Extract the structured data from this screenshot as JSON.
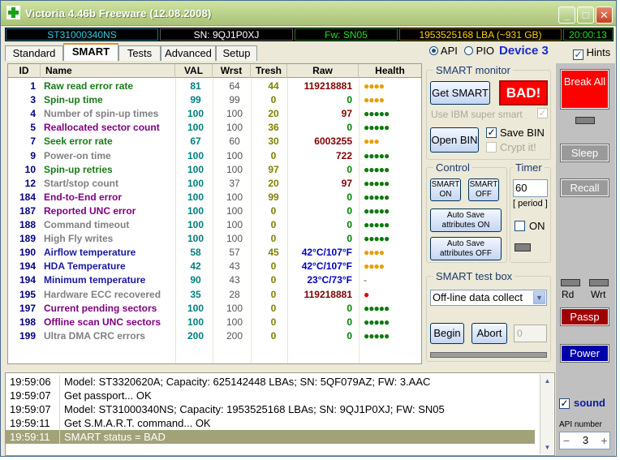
{
  "window": {
    "title": "Victoria 4.46b Freeware (12.08.2008)",
    "min_glyph": "_",
    "max_glyph": "□",
    "close_glyph": "✕"
  },
  "status": {
    "model": "ST31000340NS",
    "sn": "SN: 9QJ1P0XJ",
    "fw": "Fw: SN05",
    "lba": "1953525168 LBA (~931 GB)",
    "time": "20:00:13"
  },
  "tabs": [
    "Standard",
    "SMART",
    "Tests",
    "Advanced",
    "Setup"
  ],
  "mode": {
    "api_label": "API",
    "pio_label": "PIO",
    "device_label": "Device 3",
    "hints_label": "Hints"
  },
  "table": {
    "headers": [
      "ID",
      "Name",
      "VAL",
      "Wrst",
      "Tresh",
      "Raw",
      "Health"
    ],
    "rows": [
      {
        "id": "1",
        "name": "Raw read error rate",
        "val": "81",
        "wrst": "64",
        "tresh": "44",
        "raw": "119218881",
        "health": "●●●●",
        "name_color": "#1a7a1a",
        "health_color": "#e8a000"
      },
      {
        "id": "3",
        "name": "Spin-up time",
        "val": "99",
        "wrst": "99",
        "tresh": "0",
        "raw": "0",
        "health": "●●●●",
        "name_color": "#1a7a1a",
        "health_color": "#e8a000"
      },
      {
        "id": "4",
        "name": "Number of spin-up times",
        "val": "100",
        "wrst": "100",
        "tresh": "20",
        "raw": "97",
        "health": "●●●●●",
        "name_color": "#808080",
        "health_color": "#0a7a0a"
      },
      {
        "id": "5",
        "name": "Reallocated sector count",
        "val": "100",
        "wrst": "100",
        "tresh": "36",
        "raw": "0",
        "health": "●●●●●",
        "name_color": "#800080",
        "health_color": "#0a7a0a"
      },
      {
        "id": "7",
        "name": "Seek error rate",
        "val": "67",
        "wrst": "60",
        "tresh": "30",
        "raw": "6003255",
        "health": "●●●",
        "name_color": "#1a7a1a",
        "health_color": "#e8a000"
      },
      {
        "id": "9",
        "name": "Power-on time",
        "val": "100",
        "wrst": "100",
        "tresh": "0",
        "raw": "722",
        "health": "●●●●●",
        "name_color": "#808080",
        "health_color": "#0a7a0a"
      },
      {
        "id": "10",
        "name": "Spin-up retries",
        "val": "100",
        "wrst": "100",
        "tresh": "97",
        "raw": "0",
        "health": "●●●●●",
        "name_color": "#1a7a1a",
        "health_color": "#0a7a0a"
      },
      {
        "id": "12",
        "name": "Start/stop count",
        "val": "100",
        "wrst": "37",
        "tresh": "20",
        "raw": "97",
        "health": "●●●●●",
        "name_color": "#808080",
        "health_color": "#0a7a0a"
      },
      {
        "id": "184",
        "name": "End-to-End error",
        "val": "100",
        "wrst": "100",
        "tresh": "99",
        "raw": "0",
        "health": "●●●●●",
        "name_color": "#800080",
        "health_color": "#0a7a0a"
      },
      {
        "id": "187",
        "name": "Reported UNC error",
        "val": "100",
        "wrst": "100",
        "tresh": "0",
        "raw": "0",
        "health": "●●●●●",
        "name_color": "#800080",
        "health_color": "#0a7a0a"
      },
      {
        "id": "188",
        "name": "Command timeout",
        "val": "100",
        "wrst": "100",
        "tresh": "0",
        "raw": "0",
        "health": "●●●●●",
        "name_color": "#808080",
        "health_color": "#0a7a0a"
      },
      {
        "id": "189",
        "name": "High Fly writes",
        "val": "100",
        "wrst": "100",
        "tresh": "0",
        "raw": "0",
        "health": "●●●●●",
        "name_color": "#808080",
        "health_color": "#0a7a0a"
      },
      {
        "id": "190",
        "name": "Airflow temperature",
        "val": "58",
        "wrst": "57",
        "tresh": "45",
        "raw": "42°C/107°F",
        "health": "●●●●",
        "name_color": "#1a1aa0",
        "health_color": "#e8a000"
      },
      {
        "id": "194",
        "name": "HDA Temperature",
        "val": "42",
        "wrst": "43",
        "tresh": "0",
        "raw": "42°C/107°F",
        "health": "●●●●",
        "name_color": "#1a1aa0",
        "health_color": "#e8a000"
      },
      {
        "id": "194",
        "name": "Minimum temperature",
        "val": "90",
        "wrst": "43",
        "tresh": "0",
        "raw": "23°C/73°F",
        "health": "-",
        "name_color": "#1a1aa0",
        "health_color": "#0a7a0a"
      },
      {
        "id": "195",
        "name": "Hardware ECC recovered",
        "val": "35",
        "wrst": "28",
        "tresh": "0",
        "raw": "119218881",
        "health": "●",
        "name_color": "#808080",
        "health_color": "#e00000"
      },
      {
        "id": "197",
        "name": "Current pending sectors",
        "val": "100",
        "wrst": "100",
        "tresh": "0",
        "raw": "0",
        "health": "●●●●●",
        "name_color": "#800080",
        "health_color": "#0a7a0a"
      },
      {
        "id": "198",
        "name": "Offline scan UNC sectors",
        "val": "100",
        "wrst": "100",
        "tresh": "0",
        "raw": "0",
        "health": "●●●●●",
        "name_color": "#800080",
        "health_color": "#0a7a0a"
      },
      {
        "id": "199",
        "name": "Ultra DMA CRC errors",
        "val": "200",
        "wrst": "200",
        "tresh": "0",
        "raw": "0",
        "health": "●●●●●",
        "name_color": "#808080",
        "health_color": "#0a7a0a"
      }
    ]
  },
  "smart_monitor": {
    "label": "SMART monitor",
    "get_smart": "Get SMART",
    "status": "BAD!",
    "use_ibm": "Use IBM super smart",
    "open_bin": "Open BIN",
    "save_bin": "Save BIN",
    "crypt_it": "Crypt it!"
  },
  "control": {
    "label": "Control",
    "smart_on": "SMART ON",
    "smart_off": "SMART OFF",
    "autosave_on": "Auto Save attributes ON",
    "autosave_off": "Auto Save attributes OFF"
  },
  "timer": {
    "label": "Timer",
    "value": "60",
    "period": "[ period ]",
    "on_label": "ON"
  },
  "test_box": {
    "label": "SMART test box",
    "selected": "Off-line data collect",
    "begin": "Begin",
    "abort": "Abort",
    "value": "0"
  },
  "right": {
    "break_all": "Break All",
    "sleep": "Sleep",
    "recall": "Recall",
    "rd": "Rd",
    "wrt": "Wrt",
    "passp": "Passp",
    "power": "Power",
    "sound": "sound",
    "api_number_label": "API number",
    "api_number": "3",
    "minus": "−",
    "plus": "+"
  },
  "log": [
    {
      "time": "19:59:06",
      "msg": "Model: ST3320620A; Capacity: 625142448 LBAs; SN: 5QF079AZ; FW: 3.AAC"
    },
    {
      "time": "19:59:07",
      "msg": "Get passport... OK"
    },
    {
      "time": "19:59:07",
      "msg": "Model: ST31000340NS; Capacity: 1953525168 LBAs; SN: 9QJ1P0XJ; FW: SN05"
    },
    {
      "time": "19:59:11",
      "msg": "Get S.M.A.R.T. command... OK"
    },
    {
      "time": "19:59:11",
      "msg": "SMART status = BAD"
    }
  ]
}
